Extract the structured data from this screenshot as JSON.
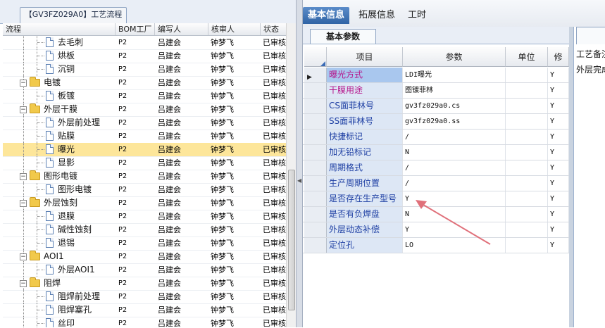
{
  "left_panel": {
    "tab_label": "【GV3FZ029A0】工艺流程",
    "columns": [
      "流程",
      "BOM工厂",
      "编写人",
      "核审人",
      "状态"
    ],
    "rows": [
      {
        "label": "去毛刺",
        "type": "doc",
        "depth": 2,
        "bom": "P2",
        "author": "吕建会",
        "reviewer": "钟梦飞",
        "status": "已审核"
      },
      {
        "label": "烘板",
        "type": "doc",
        "depth": 2,
        "bom": "P2",
        "author": "吕建会",
        "reviewer": "钟梦飞",
        "status": "已审核"
      },
      {
        "label": "沉铜",
        "type": "doc",
        "depth": 2,
        "bom": "P2",
        "author": "吕建会",
        "reviewer": "钟梦飞",
        "status": "已审核"
      },
      {
        "label": "电镀",
        "type": "folder",
        "depth": 1,
        "bom": "P2",
        "author": "吕建会",
        "reviewer": "钟梦飞",
        "status": "已审核"
      },
      {
        "label": "板镀",
        "type": "doc",
        "depth": 2,
        "bom": "P2",
        "author": "吕建会",
        "reviewer": "钟梦飞",
        "status": "已审核"
      },
      {
        "label": "外层干膜",
        "type": "folder",
        "depth": 1,
        "bom": "P2",
        "author": "吕建会",
        "reviewer": "钟梦飞",
        "status": "已审核"
      },
      {
        "label": "外层前处理",
        "type": "doc",
        "depth": 2,
        "bom": "P2",
        "author": "吕建会",
        "reviewer": "钟梦飞",
        "status": "已审核"
      },
      {
        "label": "贴膜",
        "type": "doc",
        "depth": 2,
        "bom": "P2",
        "author": "吕建会",
        "reviewer": "钟梦飞",
        "status": "已审核"
      },
      {
        "label": "曝光",
        "type": "doc",
        "depth": 2,
        "bom": "P2",
        "author": "吕建会",
        "reviewer": "钟梦飞",
        "status": "已审核",
        "selected": true
      },
      {
        "label": "显影",
        "type": "doc",
        "depth": 2,
        "bom": "P2",
        "author": "吕建会",
        "reviewer": "钟梦飞",
        "status": "已审核"
      },
      {
        "label": "图形电镀",
        "type": "folder",
        "depth": 1,
        "bom": "P2",
        "author": "吕建会",
        "reviewer": "钟梦飞",
        "status": "已审核"
      },
      {
        "label": "图形电镀",
        "type": "doc",
        "depth": 2,
        "bom": "P2",
        "author": "吕建会",
        "reviewer": "钟梦飞",
        "status": "已审核"
      },
      {
        "label": "外层蚀刻",
        "type": "folder",
        "depth": 1,
        "bom": "P2",
        "author": "吕建会",
        "reviewer": "钟梦飞",
        "status": "已审核"
      },
      {
        "label": "退膜",
        "type": "doc",
        "depth": 2,
        "bom": "P2",
        "author": "吕建会",
        "reviewer": "钟梦飞",
        "status": "已审核"
      },
      {
        "label": "碱性蚀刻",
        "type": "doc",
        "depth": 2,
        "bom": "P2",
        "author": "吕建会",
        "reviewer": "钟梦飞",
        "status": "已审核"
      },
      {
        "label": "退锡",
        "type": "doc",
        "depth": 2,
        "bom": "P2",
        "author": "吕建会",
        "reviewer": "钟梦飞",
        "status": "已审核"
      },
      {
        "label": "AOI1",
        "type": "folder",
        "depth": 1,
        "bom": "P2",
        "author": "吕建会",
        "reviewer": "钟梦飞",
        "status": "已审核"
      },
      {
        "label": "外层AOI1",
        "type": "doc",
        "depth": 2,
        "bom": "P2",
        "author": "吕建会",
        "reviewer": "钟梦飞",
        "status": "已审核"
      },
      {
        "label": "阻焊",
        "type": "folder",
        "depth": 1,
        "bom": "P2",
        "author": "吕建会",
        "reviewer": "钟梦飞",
        "status": "已审核"
      },
      {
        "label": "阻焊前处理",
        "type": "doc",
        "depth": 2,
        "bom": "P2",
        "author": "吕建会",
        "reviewer": "钟梦飞",
        "status": "已审核"
      },
      {
        "label": "阻焊塞孔",
        "type": "doc",
        "depth": 2,
        "bom": "P2",
        "author": "吕建会",
        "reviewer": "钟梦飞",
        "status": "已审核"
      },
      {
        "label": "丝印",
        "type": "doc",
        "depth": 2,
        "bom": "P2",
        "author": "吕建会",
        "reviewer": "钟梦飞",
        "status": "已审核"
      }
    ]
  },
  "right_panel": {
    "tabs": [
      "基本信息",
      "拓展信息",
      "工时"
    ],
    "active_tab": "基本信息",
    "sub_tab": "基本参数",
    "grid_columns": [
      "项目",
      "参数",
      "单位",
      "修"
    ],
    "rows": [
      {
        "item": "曝光方式",
        "param": "LDI曝光",
        "unit": "",
        "mod": "Y",
        "pink": true,
        "current": true
      },
      {
        "item": "干膜用途",
        "param": "图镀菲林",
        "unit": "",
        "mod": "Y",
        "pink": true
      },
      {
        "item": "CS面菲林号",
        "param": "gv3fz029a0.cs",
        "unit": "",
        "mod": "Y"
      },
      {
        "item": "SS面菲林号",
        "param": "gv3fz029a0.ss",
        "unit": "",
        "mod": "Y"
      },
      {
        "item": "快捷标记",
        "param": "/",
        "unit": "",
        "mod": "Y"
      },
      {
        "item": "加无铅标记",
        "param": "N",
        "unit": "",
        "mod": "Y"
      },
      {
        "item": "周期格式",
        "param": "/",
        "unit": "",
        "mod": "Y"
      },
      {
        "item": "生产周期位置",
        "param": "/",
        "unit": "",
        "mod": "Y"
      },
      {
        "item": "是否存在生产型号",
        "param": "Y",
        "unit": "",
        "mod": "Y",
        "highlight": true
      },
      {
        "item": "是否有负焊盘",
        "param": "N",
        "unit": "",
        "mod": "Y"
      },
      {
        "item": "外层动态补偿",
        "param": "Y",
        "unit": "",
        "mod": "Y"
      },
      {
        "item": "定位孔",
        "param": "LO",
        "unit": "",
        "mod": "Y"
      }
    ]
  },
  "far_right": {
    "header": "工艺备注",
    "value": "外层完成"
  },
  "colors": {
    "accent": "#2f63a5",
    "selected_row": "#fde69a",
    "annotation_arrow": "#e0707a"
  }
}
